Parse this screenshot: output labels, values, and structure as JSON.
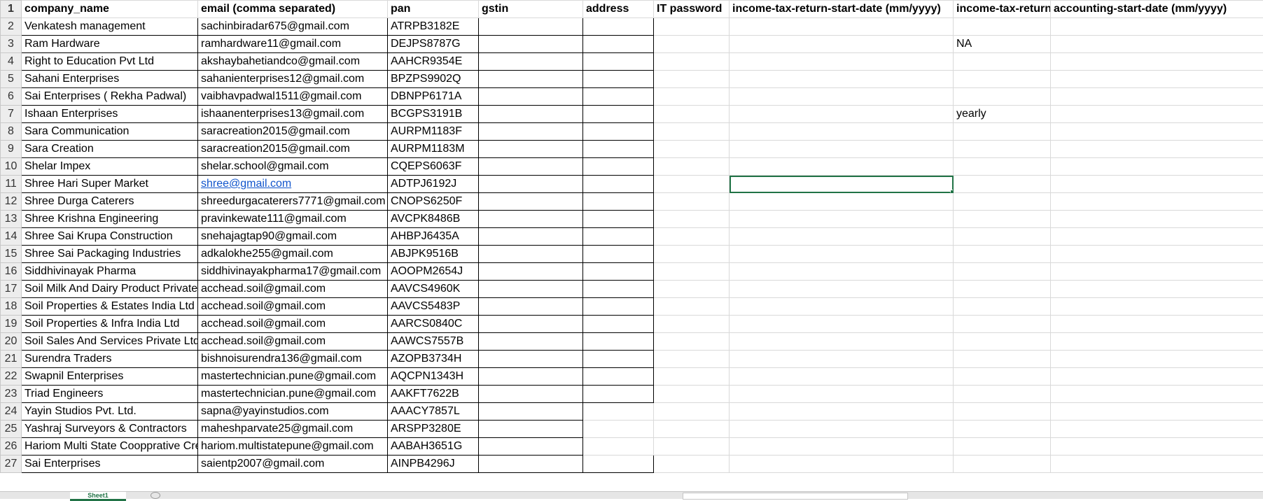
{
  "headers": [
    "company_name",
    "email (comma separated)",
    "pan",
    "gstin",
    "address",
    "IT password",
    "income-tax-return-start-date (mm/yyyy)",
    "income-tax-return",
    "accounting-start-date (mm/yyyy)"
  ],
  "rows": [
    [
      "Venkatesh management",
      "sachinbiradar675@gmail.com",
      "ATRPB3182E",
      "",
      "",
      "",
      "",
      "",
      ""
    ],
    [
      "Ram Hardware",
      "ramhardware11@gmail.com",
      "DEJPS8787G",
      "",
      "",
      "",
      "",
      "NA",
      ""
    ],
    [
      "Right to Education Pvt Ltd",
      "akshaybahetiandco@gmail.com",
      "AAHCR9354E",
      "",
      "",
      "",
      "",
      "",
      ""
    ],
    [
      "Sahani Enterprises",
      "sahanienterprises12@gmail.com",
      "BPZPS9902Q",
      "",
      "",
      "",
      "",
      "",
      ""
    ],
    [
      "Sai Enterprises ( Rekha Padwal)",
      "vaibhavpadwal1511@gmail.com",
      "DBNPP6171A",
      "",
      "",
      "",
      "",
      "",
      ""
    ],
    [
      "Ishaan Enterprises",
      "ishaanenterprises13@gmail.com",
      "BCGPS3191B",
      "",
      "",
      "",
      "",
      "yearly",
      ""
    ],
    [
      "Sara Communication",
      "saracreation2015@gmail.com",
      "AURPM1183F",
      "",
      "",
      "",
      "",
      "",
      ""
    ],
    [
      "Sara Creation",
      "saracreation2015@gmail.com",
      "AURPM1183M",
      "",
      "",
      "",
      "",
      "",
      ""
    ],
    [
      "Shelar Impex",
      "shelar.school@gmail.com",
      "CQEPS6063F",
      "",
      "",
      "",
      "",
      "",
      ""
    ],
    [
      "Shree Hari Super Market",
      "shree@gmail.com",
      "ADTPJ6192J",
      "",
      "",
      "",
      "",
      "",
      ""
    ],
    [
      "Shree Durga Caterers",
      "shreedurgacaterers7771@gmail.com",
      "CNOPS6250F",
      "",
      "",
      "",
      "",
      "",
      ""
    ],
    [
      "Shree Krishna Engineering",
      "pravinkewate111@gmail.com",
      "AVCPK8486B",
      "",
      "",
      "",
      "",
      "",
      ""
    ],
    [
      "Shree Sai Krupa Construction",
      "snehajagtap90@gmail.com",
      "AHBPJ6435A",
      "",
      "",
      "",
      "",
      "",
      ""
    ],
    [
      "Shree Sai Packaging Industries",
      "adkalokhe255@gmail.com",
      "ABJPK9516B",
      "",
      "",
      "",
      "",
      "",
      ""
    ],
    [
      "Siddhivinayak Pharma",
      "siddhivinayakpharma17@gmail.com",
      "AOOPM2654J",
      "",
      "",
      "",
      "",
      "",
      ""
    ],
    [
      "Soil Milk And Dairy Product Private Ltd",
      "acchead.soil@gmail.com",
      "AAVCS4960K",
      "",
      "",
      "",
      "",
      "",
      ""
    ],
    [
      "Soil Properties & Estates India Ltd",
      "acchead.soil@gmail.com",
      "AAVCS5483P",
      "",
      "",
      "",
      "",
      "",
      ""
    ],
    [
      "Soil Properties & Infra India Ltd",
      "acchead.soil@gmail.com",
      "AARCS0840C",
      "",
      "",
      "",
      "",
      "",
      ""
    ],
    [
      "Soil Sales And Services Private Ltd",
      "acchead.soil@gmail.com",
      "AAWCS7557B",
      "",
      "",
      "",
      "",
      "",
      ""
    ],
    [
      "Surendra Traders",
      "bishnoisurendra136@gmail.com",
      "AZOPB3734H",
      "",
      "",
      "",
      "",
      "",
      ""
    ],
    [
      "Swapnil Enterprises",
      "mastertechnician.pune@gmail.com",
      "AQCPN1343H",
      "",
      "",
      "",
      "",
      "",
      ""
    ],
    [
      "Triad Engineers",
      "mastertechnician.pune@gmail.com",
      "AAKFT7622B",
      "",
      "",
      "",
      "",
      "",
      ""
    ],
    [
      "Yayin Studios Pvt. Ltd.",
      "sapna@yayinstudios.com",
      "AAACY7857L",
      "",
      "",
      "",
      "",
      "",
      ""
    ],
    [
      "Yashraj Surveyors & Contractors",
      "maheshparvate25@gmail.com",
      "ARSPP3280E",
      "",
      "",
      "",
      "",
      "",
      ""
    ],
    [
      "Hariom Multi State Coopprative Credit Society",
      "hariom.multistatepune@gmail.com",
      "AABAH3651G",
      "",
      "",
      "",
      "",
      "",
      ""
    ],
    [
      "Sai Enterprises",
      "saientp2007@gmail.com",
      "AINPB4296J",
      "",
      "",
      "",
      "",
      "",
      ""
    ]
  ],
  "sheet_tab": "Sheet1"
}
